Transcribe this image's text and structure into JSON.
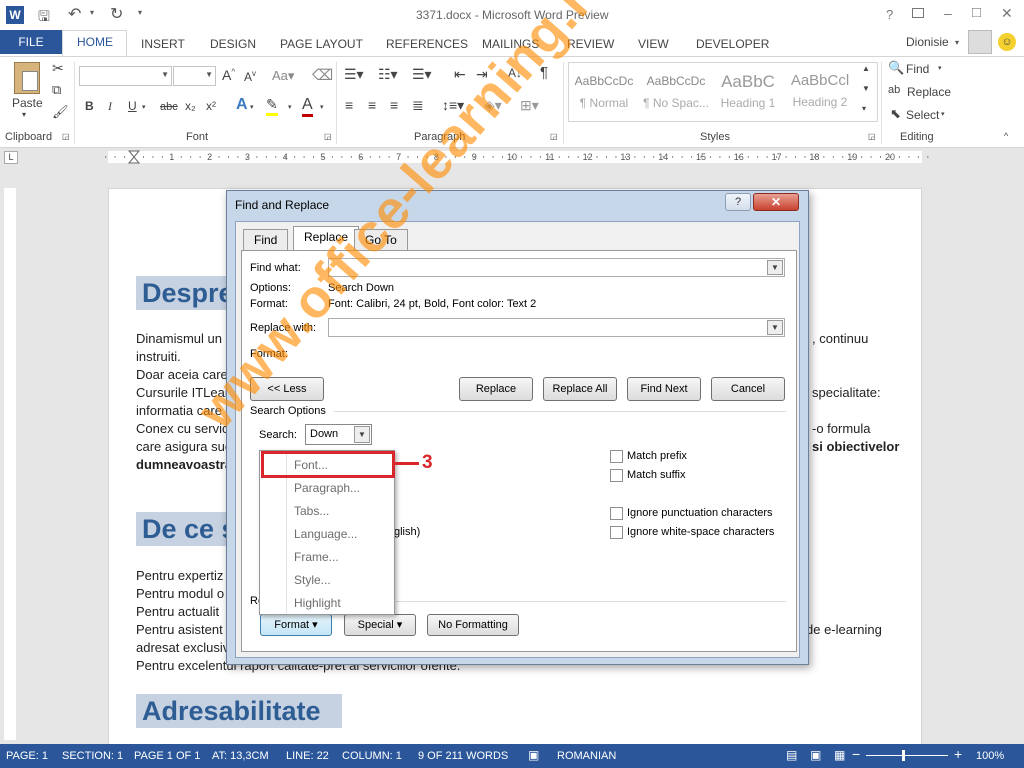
{
  "window": {
    "title": "3371.docx - Microsoft Word Preview",
    "user": "Dionisie",
    "controls": [
      "?",
      "–",
      "□",
      "✕"
    ]
  },
  "ribbon_tabs": [
    "FILE",
    "HOME",
    "INSERT",
    "DESIGN",
    "PAGE LAYOUT",
    "REFERENCES",
    "MAILINGS",
    "REVIEW",
    "VIEW",
    "DEVELOPER"
  ],
  "ribbon": {
    "clipboard": {
      "paste": "Paste",
      "group": "Clipboard"
    },
    "font": {
      "group": "Font",
      "bold": "B",
      "italic": "I",
      "underline": "U",
      "strike": "abc",
      "sub": "x₂",
      "sup": "x²"
    },
    "paragraph": {
      "group": "Paragraph"
    },
    "styles": {
      "group": "Styles",
      "items": [
        {
          "preview": "AaBbCcDc",
          "name": "¶ Normal"
        },
        {
          "preview": "AaBbCcDc",
          "name": "¶ No Spac..."
        },
        {
          "preview": "AaBbC",
          "name": "Heading 1"
        },
        {
          "preview": "AaBbCcl",
          "name": "Heading 2"
        }
      ]
    },
    "editing": {
      "group": "Editing",
      "find": "Find",
      "replace": "Replace",
      "select": "Select"
    }
  },
  "ruler_numbers": [
    "2",
    "1",
    "1",
    "2",
    "3",
    "4",
    "5",
    "6",
    "7",
    "8",
    "9",
    "10",
    "11",
    "12",
    "13",
    "14",
    "15",
    "16",
    "17",
    "18",
    "19",
    "20"
  ],
  "document": {
    "heading1": "Despre",
    "lines1": [
      "Dinamismul un",
      "instruiti.",
      "Doar aceia care",
      "Cursurile ITLear",
      "informatia care",
      "Conex cu servic",
      "care asigura suc",
      "dumneavoastra"
    ],
    "right1": [
      ", continuu",
      "specialitate:",
      "-o formula",
      "si obiectivelor"
    ],
    "heading2": "De ce s",
    "glish": "glish)",
    "lines2": [
      "Pentru expertiz",
      "Pentru modul o",
      "Pentru actualit",
      "Pentru asistent",
      "adresat exclusiv",
      "Pentru excelentul raport calitate-pret al serviciilor oferite."
    ],
    "right2": "de e-learning",
    "heading3": "Adresabilitate"
  },
  "dialog": {
    "title": "Find and Replace",
    "tabs": [
      "Find",
      "Replace",
      "Go To"
    ],
    "find_label": "Find what:",
    "find_value": "",
    "options_label": "Options:",
    "options_value": "Search Down",
    "format_label": "Format:",
    "format_value": "Font: Calibri, 24 pt, Bold, Font color: Text 2",
    "replace_label": "Replace with:",
    "replace_value": "",
    "replace_format_label": "Format:",
    "buttons": {
      "less": "<< Less",
      "replace": "Replace",
      "replace_all": "Replace All",
      "find_next": "Find Next",
      "cancel": "Cancel"
    },
    "search_options": "Search Options",
    "search_label": "Search:",
    "search_value": "Down",
    "checks_right": [
      "Match prefix",
      "Match suffix",
      "Ignore punctuation characters",
      "Ignore white-space characters"
    ],
    "replace_section_label": "Re",
    "bottom_buttons": {
      "format": "Format ▾",
      "special": "Special ▾",
      "no_formatting": "No Formatting"
    }
  },
  "format_menu": [
    "Font...",
    "Paragraph...",
    "Tabs...",
    "Language...",
    "Frame...",
    "Style...",
    "Highlight"
  ],
  "annotation": {
    "number": "3",
    "color": "#d9262a"
  },
  "watermark": "www.office-learning.ro",
  "status_bar": {
    "items": [
      "PAGE: 1",
      "SECTION: 1",
      "PAGE 1 OF 1",
      "AT: 13,3CM",
      "LINE: 22",
      "COLUMN: 1",
      "9 OF 211 WORDS",
      "ROMANIAN"
    ],
    "zoom": "100%"
  },
  "colors": {
    "accent": "#2b579a",
    "heading_bg": "#c6d2e2",
    "heading_text": "#2e5d94",
    "highlight_box": "#d9262a",
    "watermark": "#ff8c00"
  }
}
